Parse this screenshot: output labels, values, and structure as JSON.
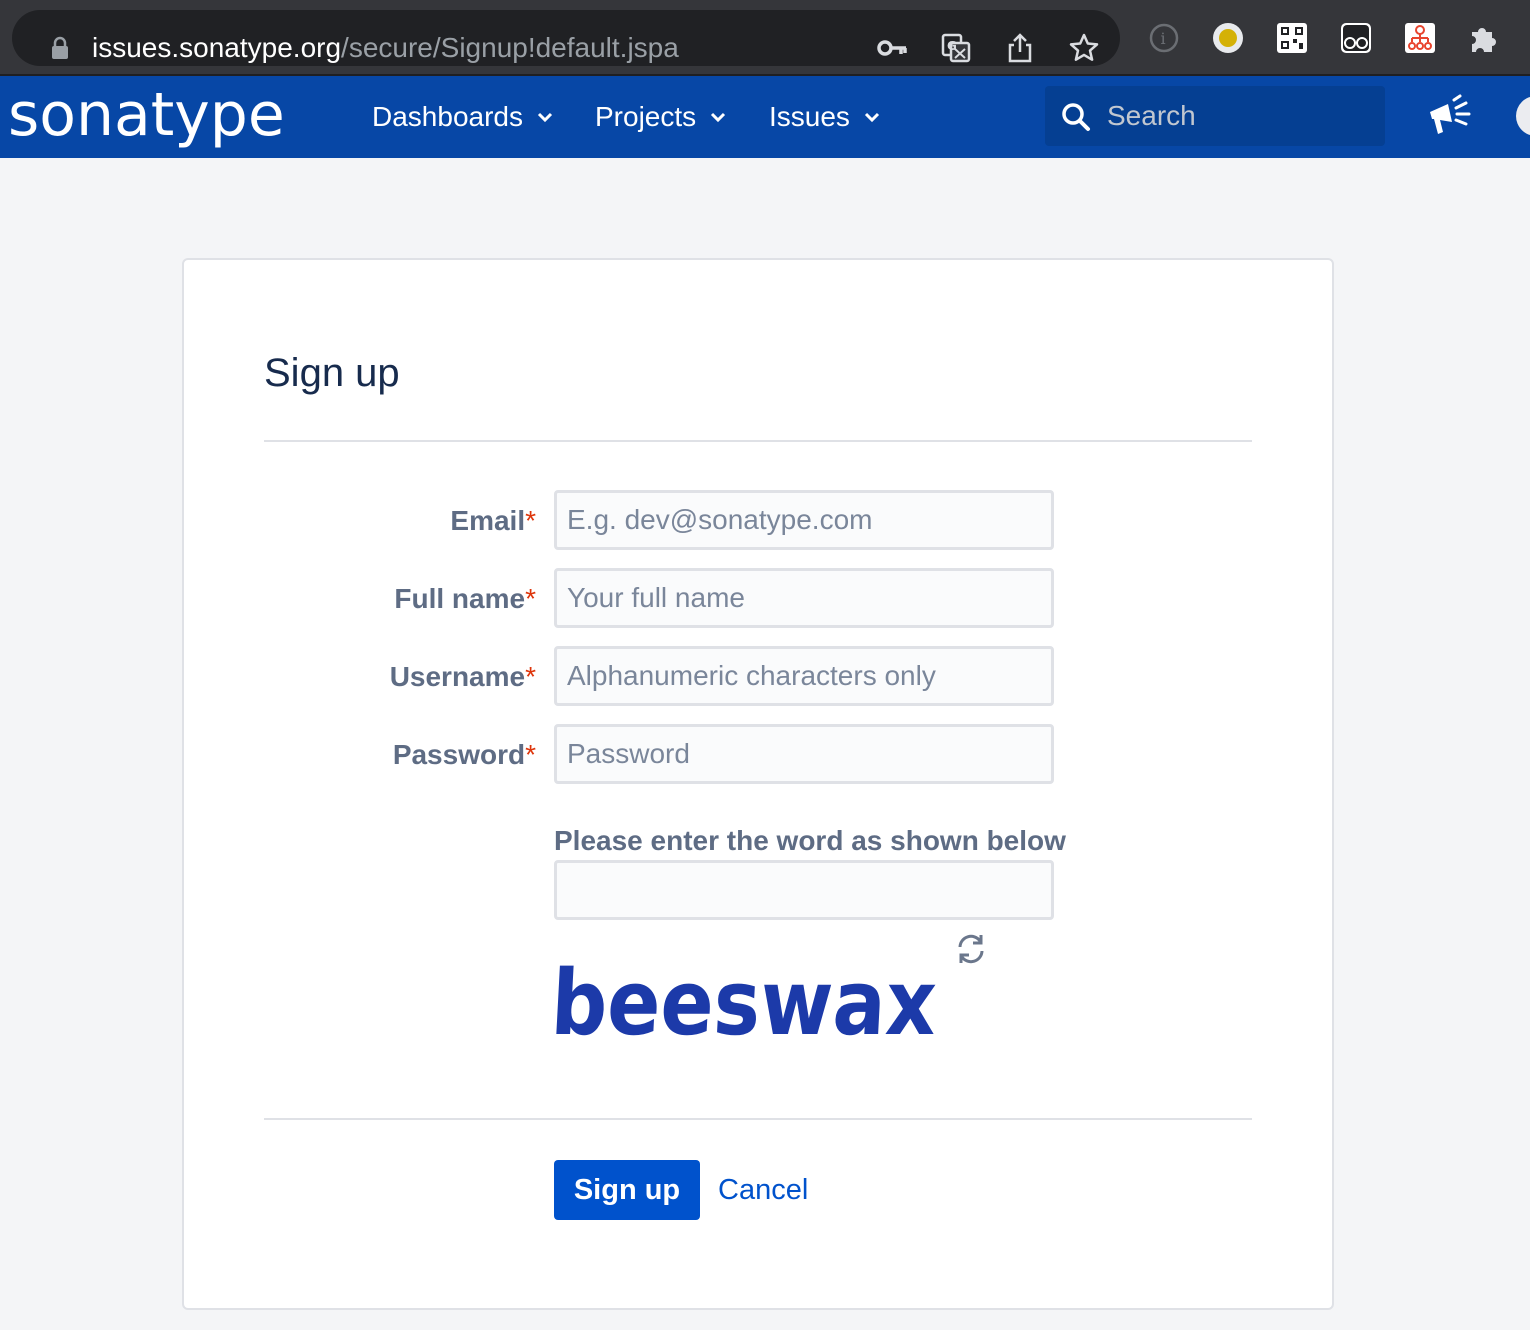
{
  "browser": {
    "url_host": "issues.sonatype.org",
    "url_path": "/secure/Signup!default.jspa",
    "omnibox_icons": [
      "key-icon",
      "translate-icon",
      "share-icon",
      "bookmark-star-icon"
    ],
    "extension_icons": [
      "info-extension-icon",
      "yellow-dot-extension-icon",
      "qr-code-extension-icon",
      "glasses-extension-icon",
      "sitemap-extension-icon",
      "puzzle-extensions-icon"
    ]
  },
  "header": {
    "logo": "sonatype",
    "nav": [
      {
        "label": "Dashboards"
      },
      {
        "label": "Projects"
      },
      {
        "label": "Issues"
      }
    ],
    "search_placeholder": "Search",
    "background_color": "#0747a6"
  },
  "form": {
    "title": "Sign up",
    "fields": [
      {
        "label": "Email",
        "required_mark": "*",
        "placeholder": "E.g. dev@sonatype.com",
        "value": ""
      },
      {
        "label": "Full name",
        "required_mark": "*",
        "placeholder": "Your full name",
        "value": ""
      },
      {
        "label": "Username",
        "required_mark": "*",
        "placeholder": "Alphanumeric characters only",
        "value": ""
      },
      {
        "label": "Password",
        "required_mark": "*",
        "placeholder": "Password",
        "value": ""
      }
    ],
    "captcha": {
      "label": "Please enter the word as shown below",
      "value": "",
      "word": "beeswax"
    },
    "submit_label": "Sign up",
    "cancel_label": "Cancel",
    "accent_color": "#0052cc",
    "required_color": "#de350b"
  }
}
